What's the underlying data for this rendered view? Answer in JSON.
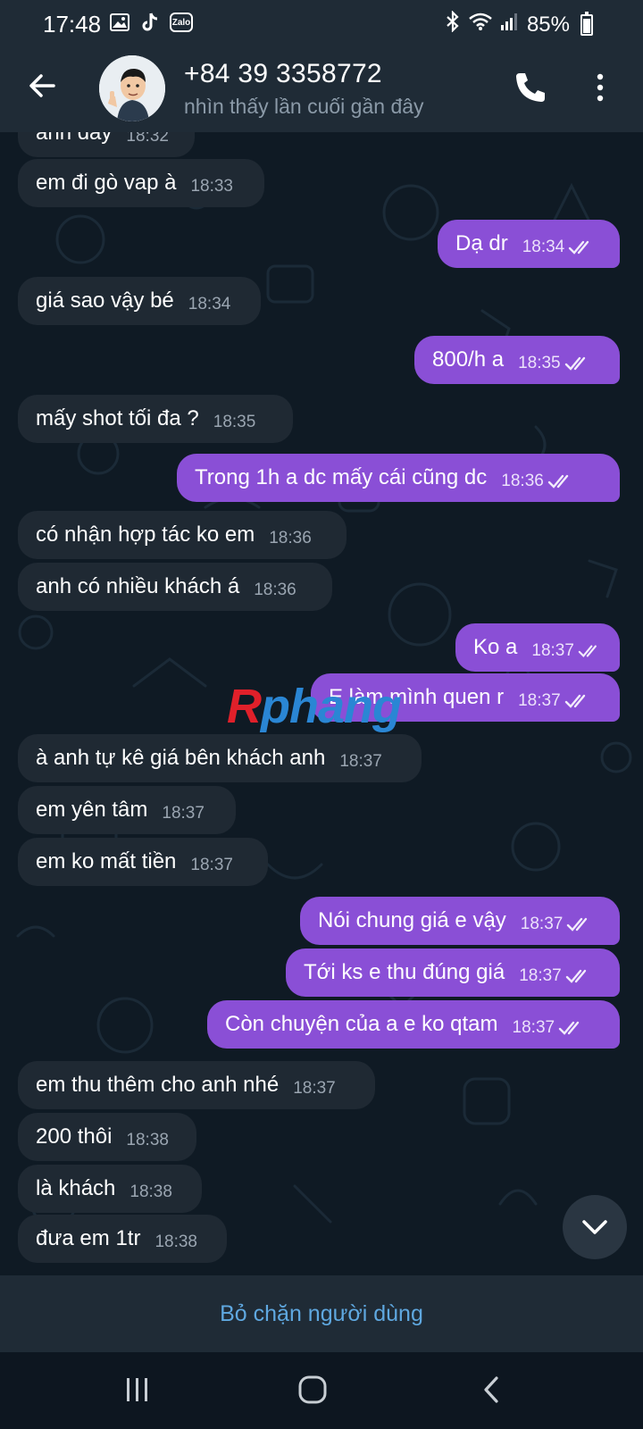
{
  "status_bar": {
    "time": "17:48",
    "app_icons": [
      "gallery-icon",
      "tiktok-icon",
      "zalo-icon"
    ],
    "zalo_label": "Zalo",
    "battery": "85%"
  },
  "header": {
    "contact_name": "+84 39 3358772",
    "last_seen": "nhìn thấy lần cuối gần đây"
  },
  "messages": [
    {
      "dir": "in",
      "text": "anh đây",
      "time": "18:32"
    },
    {
      "dir": "in",
      "text": "em đi gò vap à",
      "time": "18:33"
    },
    {
      "dir": "out",
      "text": "Dạ dr",
      "time": "18:34"
    },
    {
      "dir": "in",
      "text": "giá sao vậy bé",
      "time": "18:34"
    },
    {
      "dir": "out",
      "text": "800/h a",
      "time": "18:35"
    },
    {
      "dir": "in",
      "text": "mấy shot tối đa ?",
      "time": "18:35"
    },
    {
      "dir": "out",
      "text": "Trong 1h a dc mấy cái cũng dc",
      "time": "18:36"
    },
    {
      "dir": "in",
      "text": "có nhận hợp tác ko em",
      "time": "18:36"
    },
    {
      "dir": "in",
      "text": "anh có nhiều khách á",
      "time": "18:36"
    },
    {
      "dir": "out",
      "text": "Ko a",
      "time": "18:37"
    },
    {
      "dir": "out",
      "text": "E làm mình quen r",
      "time": "18:37"
    },
    {
      "dir": "in",
      "text": "à anh tự kê giá bên khách anh",
      "time": "18:37"
    },
    {
      "dir": "in",
      "text": "em yên tâm",
      "time": "18:37"
    },
    {
      "dir": "in",
      "text": "em ko mất tiền",
      "time": "18:37"
    },
    {
      "dir": "out",
      "text": "Nói chung giá e vậy",
      "time": "18:37"
    },
    {
      "dir": "out",
      "text": "Tới ks e thu đúng giá",
      "time": "18:37"
    },
    {
      "dir": "out",
      "text": "Còn chuyện của a e ko qtam",
      "time": "18:37"
    },
    {
      "dir": "in",
      "text": "em thu thêm cho anh nhé",
      "time": "18:37"
    },
    {
      "dir": "in",
      "text": "200 thôi",
      "time": "18:38"
    },
    {
      "dir": "in",
      "text": "là khách",
      "time": "18:38"
    },
    {
      "dir": "in",
      "text": "đưa em 1tr",
      "time": "18:38"
    }
  ],
  "watermark": {
    "first": "R",
    "rest": "phang"
  },
  "unblock_label": "Bỏ chặn người dùng",
  "colors": {
    "incoming": "#1f2933",
    "outgoing": "#8a4fd6",
    "link": "#5fa8e0"
  }
}
